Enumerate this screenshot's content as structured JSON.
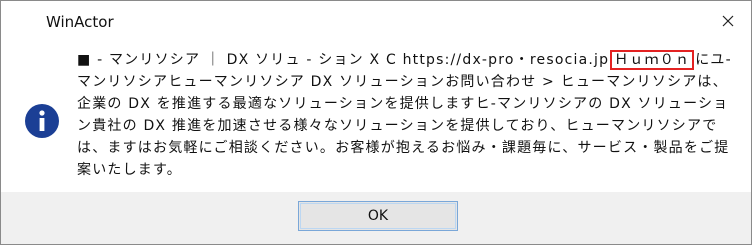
{
  "window": {
    "title": "WinActor"
  },
  "message": {
    "part1": "■ - マンリソシア ｜ DX ソリュ - ション X C https://dx-pro・resocia.jp",
    "highlighted": "Ｈｕｍ０ｎ",
    "part2": "にユ-マンリソシアヒューマンリソシア DX ソリューションお問い合わせ > ヒューマンリソシアは、企業の DX を推進する最適なソリューションを提供しますヒ-マンリソシアの DX ソリューション貴社の DX 推進を加速させる様々なソリューションを提供しており、ヒューマンリソシアでは、ますはお気軽にご相談ください。お客様が抱えるお悩み・課題毎に、サービス・製品をご提案いたします。"
  },
  "icons": {
    "info": "info-icon",
    "close": "close-icon"
  },
  "buttons": {
    "ok": "OK"
  },
  "colors": {
    "info_icon_bg": "#1b3f95",
    "highlight_border": "#e32222",
    "footer_bg": "#f0f0f0",
    "button_border": "#7aa7d8"
  }
}
